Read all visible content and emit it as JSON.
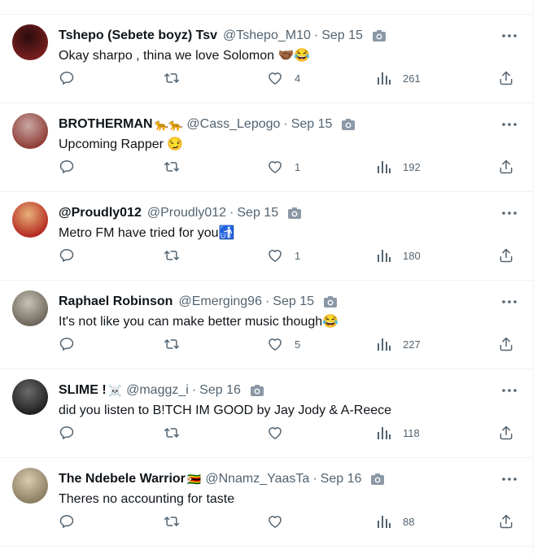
{
  "tweets": [
    {
      "name": "Tshepo (Sebete boyz) Tsv",
      "name_emoji": "",
      "handle": "@Tshepo_M10",
      "date": "Sep 15",
      "text": "Okay sharpo , thina we love Solomon 🤝🏾😂",
      "likes": "4",
      "views": "261",
      "avatar_colors": [
        "#2a0d0d",
        "#7a1e1e"
      ]
    },
    {
      "name": "BROTHERMAN",
      "name_emoji": "🐆🐆",
      "handle": "@Cass_Lepogo",
      "date": "Sep 15",
      "text": "Upcoming Rapper 😏",
      "likes": "1",
      "views": "192",
      "avatar_colors": [
        "#c9a6a2",
        "#8e3b35"
      ]
    },
    {
      "name": "@Proudly012",
      "name_emoji": "",
      "handle": "@Proudly012",
      "date": "Sep 15",
      "text": "Metro FM have tried for you🚮",
      "likes": "1",
      "views": "180",
      "avatar_colors": [
        "#e8b27a",
        "#b3261e"
      ]
    },
    {
      "name": "Raphael Robinson",
      "name_emoji": "",
      "handle": "@Emerging96",
      "date": "Sep 15",
      "text": "It's not like you can make better music though😂",
      "likes": "5",
      "views": "227",
      "avatar_colors": [
        "#c8c2b6",
        "#6c6458"
      ]
    },
    {
      "name": "SLIME !",
      "name_emoji": "☠️",
      "handle": "@maggz_i",
      "date": "Sep 16",
      "text": "did you listen to B!TCH IM GOOD by Jay Jody & A-Reece",
      "likes": "",
      "views": "118",
      "avatar_colors": [
        "#6b6b6b",
        "#1e1e1e"
      ]
    },
    {
      "name": "The Ndebele Warrior",
      "name_emoji": "🇿🇼",
      "handle": "@Nnamz_YaasTa",
      "date": "Sep 16",
      "text": "Theres no accounting for taste",
      "likes": "",
      "views": "88",
      "avatar_colors": [
        "#d8cbb0",
        "#8a7c60"
      ]
    }
  ],
  "icons": {
    "photo": "camera-icon",
    "more": "more-icon",
    "reply": "reply-icon",
    "retweet": "retweet-icon",
    "like": "like-icon",
    "views": "views-icon",
    "share": "share-icon"
  },
  "colors": {
    "icon_gray": "#536471",
    "text": "#0f1419",
    "border": "#eff3f4"
  }
}
